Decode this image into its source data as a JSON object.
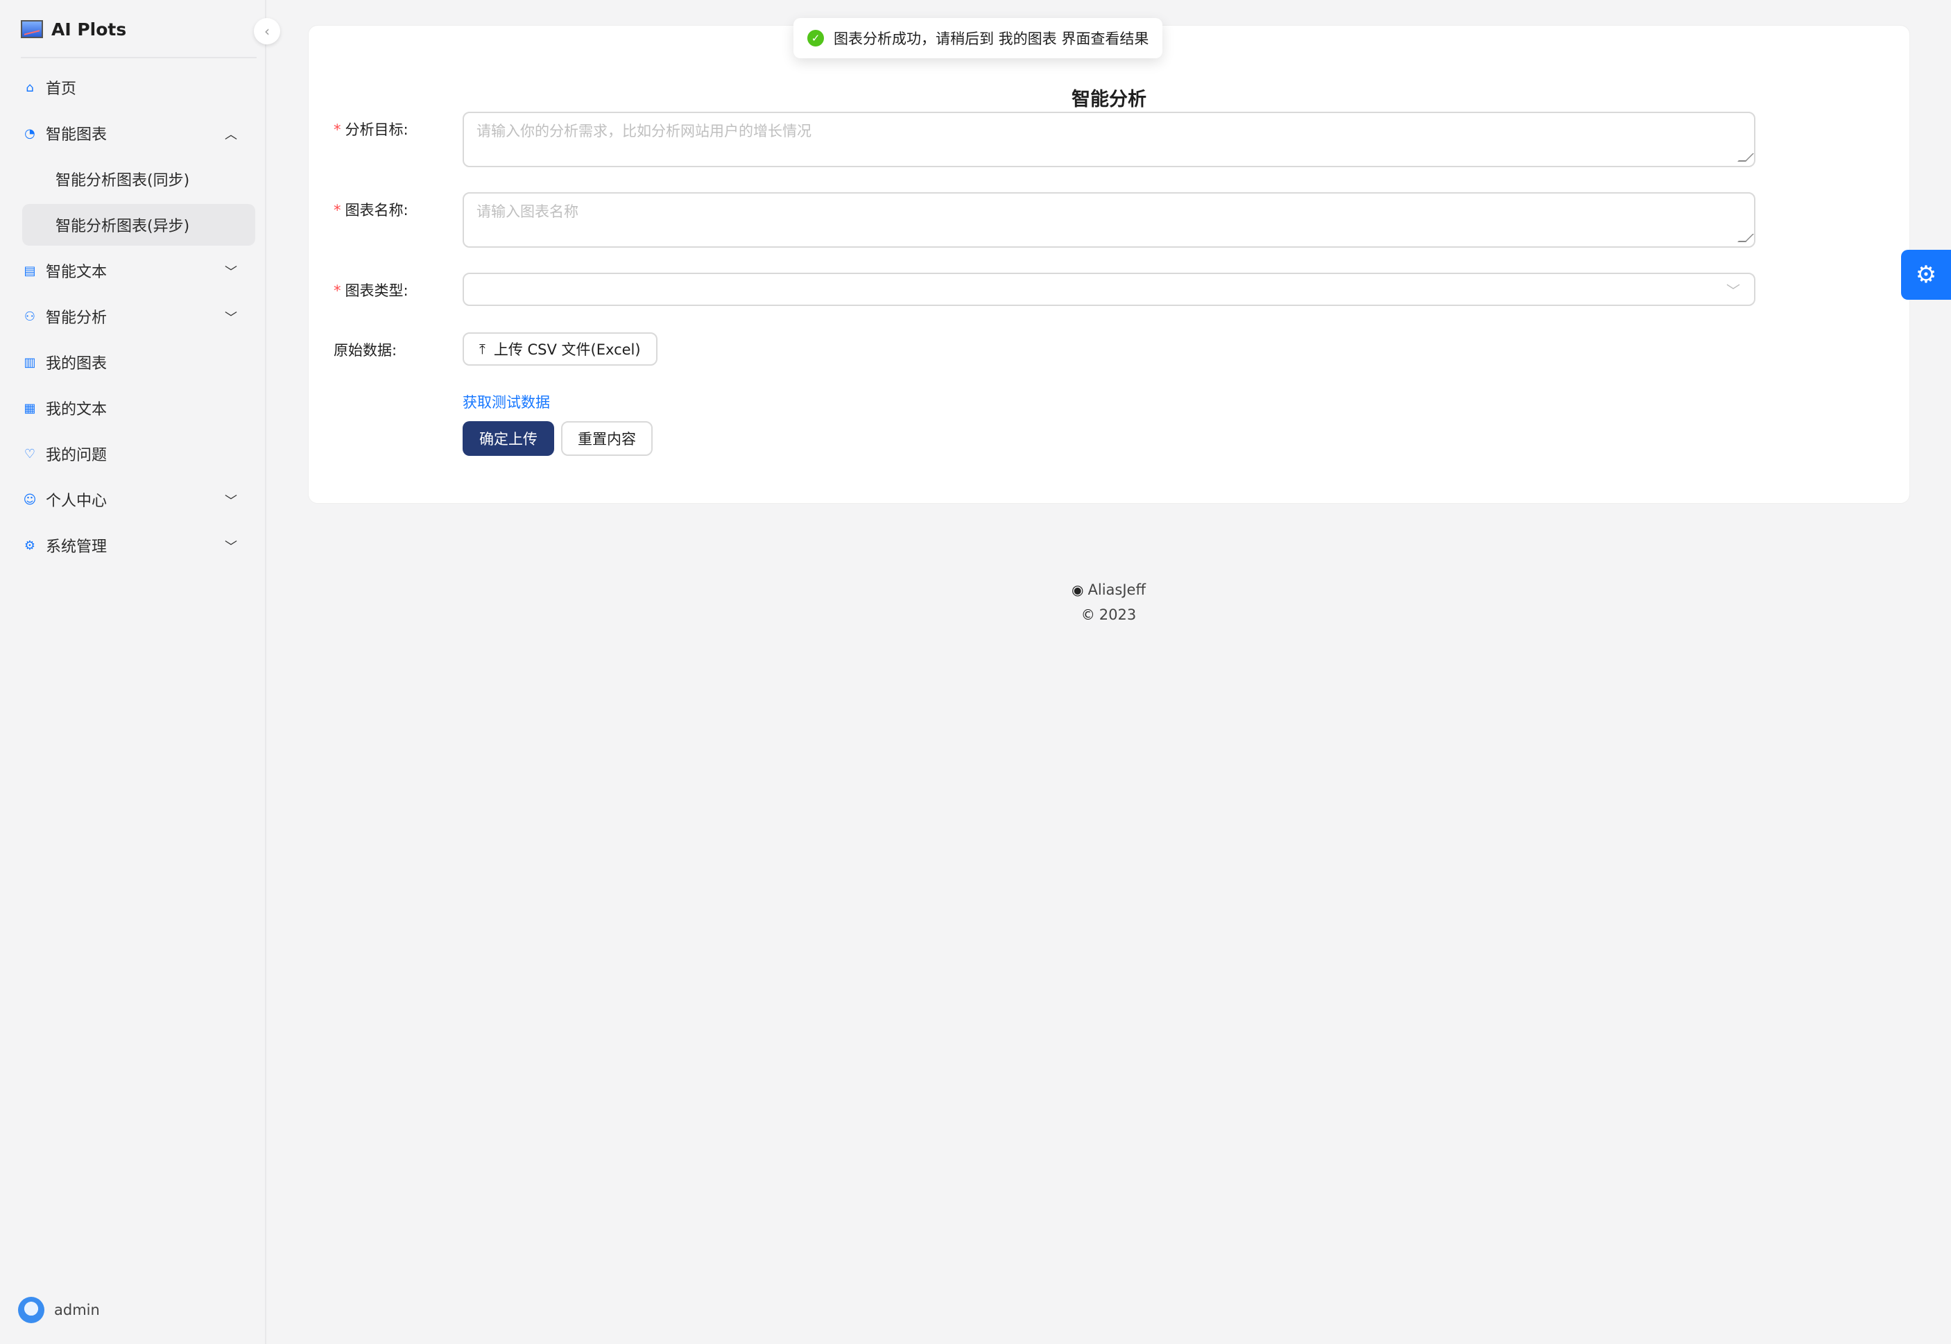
{
  "brand": {
    "title": "AI Plots",
    "logo_icon": "chart-logo-icon"
  },
  "sidebar": {
    "collapse_icon": "‹",
    "items": [
      {
        "label": "首页",
        "icon": "home-icon",
        "glyph": "⌂",
        "has_children": false
      },
      {
        "label": "智能图表",
        "icon": "pie-chart-icon",
        "glyph": "◔",
        "has_children": true,
        "expanded": true,
        "children": [
          {
            "label": "智能分析图表(同步)",
            "active": false
          },
          {
            "label": "智能分析图表(异步)",
            "active": true
          }
        ]
      },
      {
        "label": "智能文本",
        "icon": "file-text-icon",
        "glyph": "▤",
        "has_children": true,
        "expanded": false
      },
      {
        "label": "智能分析",
        "icon": "robot-icon",
        "glyph": "⚙",
        "has_children": true,
        "expanded": false
      },
      {
        "label": "我的图表",
        "icon": "bar-chart-icon",
        "glyph": "▥",
        "has_children": false
      },
      {
        "label": "我的文本",
        "icon": "doc-icon",
        "glyph": "▦",
        "has_children": false
      },
      {
        "label": "我的问题",
        "icon": "bulb-icon",
        "glyph": "♡",
        "has_children": false
      },
      {
        "label": "个人中心",
        "icon": "smile-icon",
        "glyph": "☺",
        "has_children": true,
        "expanded": false
      },
      {
        "label": "系统管理",
        "icon": "setting-icon",
        "glyph": "⚙",
        "has_children": true,
        "expanded": false
      }
    ]
  },
  "user": {
    "name": "admin"
  },
  "toast": {
    "message": "图表分析成功，请稍后到 我的图表 界面查看结果",
    "icon": "check-circle-icon"
  },
  "form": {
    "title": "智能分析",
    "goal": {
      "label": "分析目标:",
      "placeholder": "请输入你的分析需求，比如分析网站用户的增长情况",
      "required": true
    },
    "name": {
      "label": "图表名称:",
      "placeholder": "请输入图表名称",
      "required": true
    },
    "type": {
      "label": "图表类型:",
      "value": "",
      "required": true
    },
    "raw": {
      "label": "原始数据:",
      "upload_label": "上传 CSV 文件(Excel)"
    },
    "test_link": "获取测试数据",
    "submit_label": "确定上传",
    "reset_label": "重置内容"
  },
  "footer": {
    "author": "AliasJeff",
    "year": "2023"
  },
  "colors": {
    "primary": "#243a74",
    "link": "#1677ff",
    "success": "#52c41a",
    "required": "#ff4d4f"
  }
}
